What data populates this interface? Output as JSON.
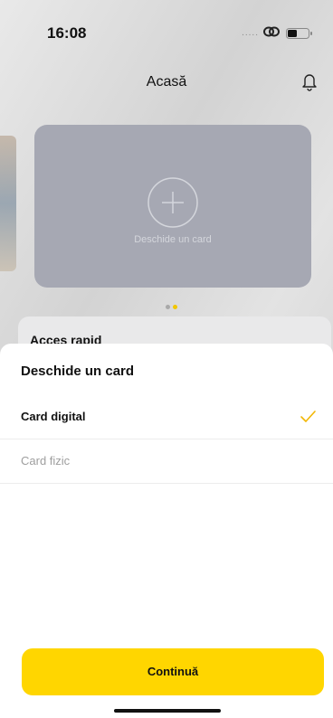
{
  "status_bar": {
    "time": "16:08",
    "dots": "....."
  },
  "header": {
    "title": "Acasă",
    "notifications_icon": "bell-icon"
  },
  "card_panel": {
    "label": "Deschide un card",
    "icon": "plus-circle-icon"
  },
  "pager": {
    "pages": 2,
    "active": 2,
    "active_color": "#f2c600"
  },
  "quick_access": {
    "title": "Acces rapid"
  },
  "sheet": {
    "title": "Deschide un card",
    "options": [
      {
        "label": "Card digital",
        "selected": true
      },
      {
        "label": "Card fizic",
        "selected": false
      }
    ],
    "continue_label": "Continuă",
    "accent": "#ffd600",
    "check_color": "#f2b705"
  }
}
